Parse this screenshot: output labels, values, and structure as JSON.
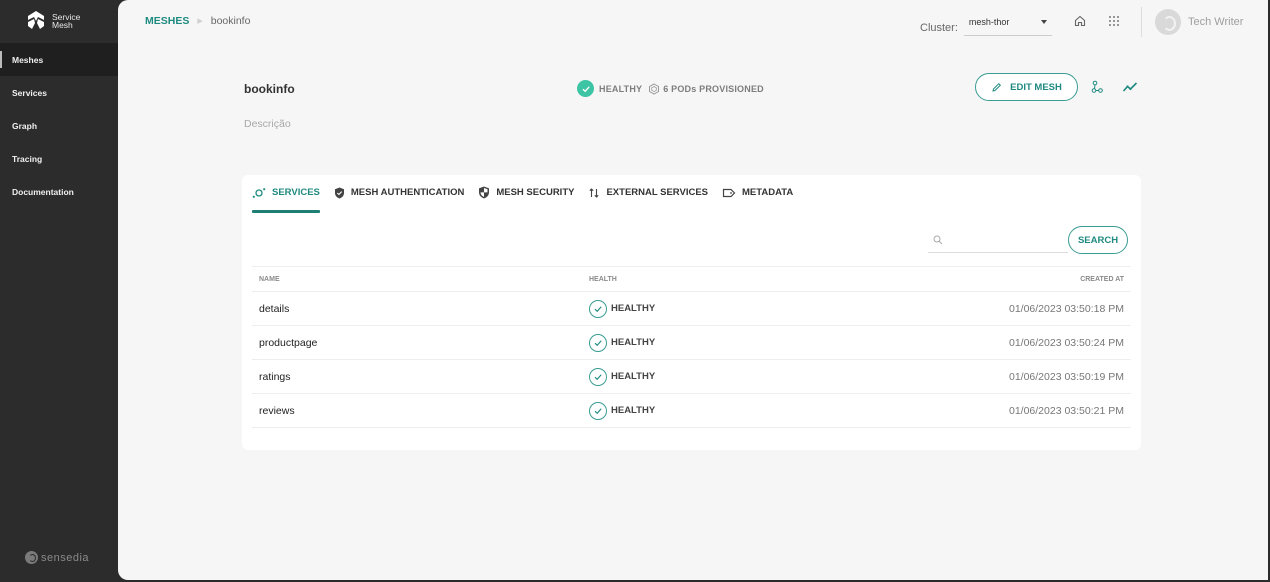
{
  "app": {
    "logo_line1": "Service",
    "logo_line2": "Mesh",
    "footer_brand": "sensedia"
  },
  "sidebar": {
    "items": [
      {
        "label": "Meshes",
        "active": true
      },
      {
        "label": "Services",
        "active": false
      },
      {
        "label": "Graph",
        "active": false
      },
      {
        "label": "Tracing",
        "active": false
      },
      {
        "label": "Documentation",
        "active": false
      }
    ]
  },
  "breadcrumb": {
    "root": "MESHES",
    "current": "bookinfo"
  },
  "topbar": {
    "cluster_label": "Cluster:",
    "cluster_value": "mesh-thor",
    "home_icon": "home-icon",
    "apps_icon": "apps-grid-icon",
    "user_name": "Tech Writer"
  },
  "mesh": {
    "name": "bookinfo",
    "description": "Descrição",
    "health": "HEALTHY",
    "pods": "6 PODs PROVISIONED",
    "edit_label": "EDIT MESH",
    "accent": "#1f8a80"
  },
  "tabs": [
    {
      "label": "SERVICES",
      "icon": "services-icon",
      "active": true
    },
    {
      "label": "MESH AUTHENTICATION",
      "icon": "shield-check-icon",
      "active": false
    },
    {
      "label": "MESH SECURITY",
      "icon": "shield-half-icon",
      "active": false
    },
    {
      "label": "EXTERNAL SERVICES",
      "icon": "swap-vertical-icon",
      "active": false
    },
    {
      "label": "METADATA",
      "icon": "label-icon",
      "active": false
    }
  ],
  "search": {
    "placeholder": "",
    "value": "",
    "button_label": "SEARCH"
  },
  "table": {
    "columns": [
      "NAME",
      "HEALTH",
      "CREATED AT"
    ],
    "rows": [
      {
        "name": "details",
        "health": "HEALTHY",
        "created": "01/06/2023 03:50:18 PM"
      },
      {
        "name": "productpage",
        "health": "HEALTHY",
        "created": "01/06/2023 03:50:24 PM"
      },
      {
        "name": "ratings",
        "health": "HEALTHY",
        "created": "01/06/2023 03:50:19 PM"
      },
      {
        "name": "reviews",
        "health": "HEALTHY",
        "created": "01/06/2023 03:50:21 PM"
      }
    ]
  }
}
